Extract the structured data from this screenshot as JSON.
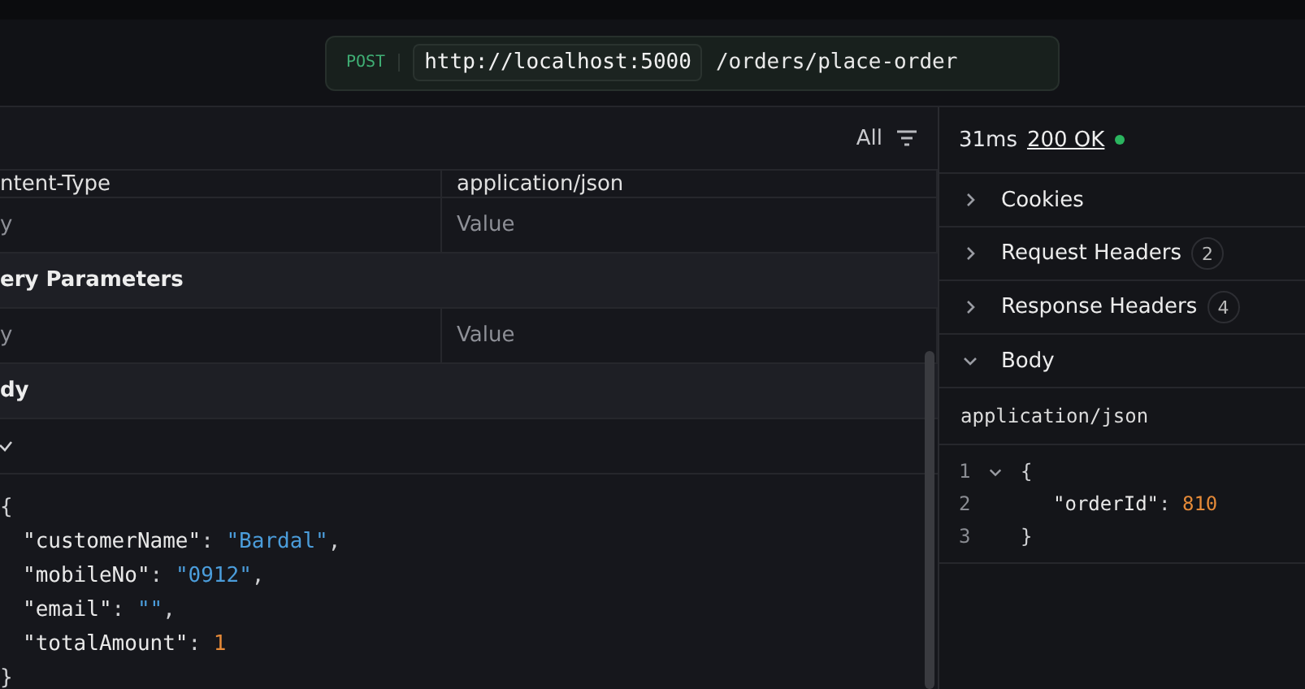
{
  "url_bar": {
    "method": "POST",
    "base": "http://localhost:5000",
    "path": "/orders/place-order"
  },
  "request": {
    "filter": "All",
    "headers": [
      {
        "key": {
          "value": "ntent-Type"
        },
        "value": {
          "value": "application/json"
        }
      },
      {
        "key": {
          "placeholder": "y"
        },
        "value": {
          "placeholder": "Value"
        }
      }
    ],
    "query_section": "ery Parameters",
    "query_rows": [
      {
        "key": {
          "placeholder": "y"
        },
        "value": {
          "placeholder": "Value"
        }
      }
    ],
    "body_section": "dy",
    "body_code": [
      [
        {
          "kind": "punct",
          "text": "{"
        }
      ],
      [
        {
          "kind": "key",
          "text": "\"customerName\""
        },
        {
          "kind": "punct",
          "text": ": "
        },
        {
          "kind": "string",
          "text": "\"Bardal\""
        },
        {
          "kind": "punct",
          "text": ","
        }
      ],
      [
        {
          "kind": "key",
          "text": "\"mobileNo\""
        },
        {
          "kind": "punct",
          "text": ": "
        },
        {
          "kind": "string",
          "text": "\"0912\""
        },
        {
          "kind": "punct",
          "text": ","
        }
      ],
      [
        {
          "kind": "key",
          "text": "\"email\""
        },
        {
          "kind": "punct",
          "text": ": "
        },
        {
          "kind": "string",
          "text": "\"\""
        },
        {
          "kind": "punct",
          "text": ","
        }
      ],
      [
        {
          "kind": "key",
          "text": "\"totalAmount\""
        },
        {
          "kind": "punct",
          "text": ": "
        },
        {
          "kind": "number",
          "text": "1"
        }
      ],
      [
        {
          "kind": "punct",
          "text": "}"
        }
      ]
    ]
  },
  "response": {
    "time": "31ms",
    "status": "200 OK",
    "sections": [
      {
        "label": "Cookies",
        "expanded": false
      },
      {
        "label": "Request Headers",
        "count": "2",
        "expanded": false
      },
      {
        "label": "Response Headers",
        "count": "4",
        "expanded": false
      },
      {
        "label": "Body",
        "expanded": true
      }
    ],
    "content_type": "application/json",
    "code": [
      {
        "number": "1",
        "foldable": true,
        "tokens": [
          {
            "kind": "punct",
            "text": "{"
          }
        ]
      },
      {
        "number": "2",
        "foldable": false,
        "tokens": [
          {
            "kind": "key",
            "text": "\"orderId\""
          },
          {
            "kind": "punct",
            "text": ": "
          },
          {
            "kind": "number",
            "text": "810"
          }
        ]
      },
      {
        "number": "3",
        "foldable": false,
        "tokens": [
          {
            "kind": "punct",
            "text": "}"
          }
        ]
      }
    ]
  }
}
